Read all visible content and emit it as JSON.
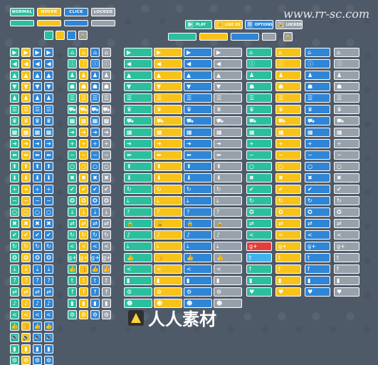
{
  "states": {
    "normal": "NORMAL",
    "hover": "HOVER",
    "click": "CLICK",
    "locked": "LOCKED"
  },
  "top_buttons": {
    "play": "PLAY",
    "like": "LIKE US",
    "options": "OPTIONS",
    "locked": "LOCKED"
  },
  "watermark": {
    "site": "www.rr-sc.com",
    "brand": "人人素材"
  },
  "icons": {
    "play": "▶",
    "left": "◀",
    "up": "▲",
    "down": "▼",
    "home": "⌂",
    "info": "ⓘ",
    "user": "♟",
    "users": "☗",
    "list": "☰",
    "cup": "♛",
    "cart": "⛟",
    "grid": "▦",
    "right_arrow": "➜",
    "left_arrow": "⬅",
    "up_arrow": "⬆",
    "down_arrow": "⬇",
    "plus": "+",
    "minus": "−",
    "circle": "○",
    "cross": "✖",
    "check": "✔",
    "refresh": "↻",
    "award": "✪",
    "download": "⤓",
    "question": "?",
    "swap": "⇄",
    "music": "♪",
    "share": "<",
    "like": "👍",
    "facebook": "f",
    "twitter": "t",
    "gplus": "g+",
    "volume": "🔊",
    "bars": "▮",
    "gear": "⚙",
    "heart": "♥",
    "smile": "☻",
    "lock": "🔒"
  }
}
